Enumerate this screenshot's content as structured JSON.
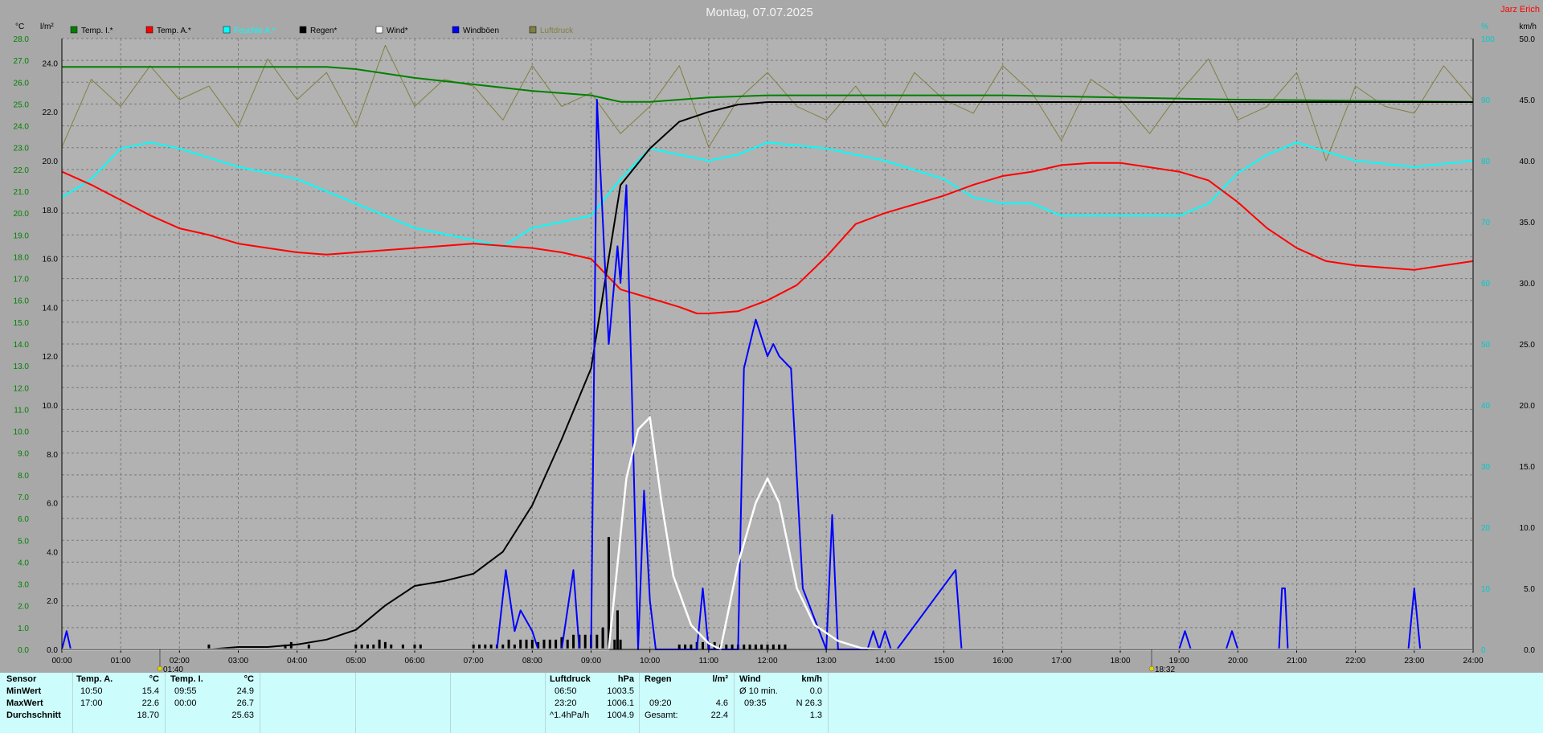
{
  "title": "Montag, 07.07.2025",
  "credit": "Jarz Erich",
  "colors": {
    "plot_bg": "#b2b2b2",
    "left_axis": "#008000",
    "right_axis": "#00c8c8",
    "grid": "#7a7a7a"
  },
  "axes": {
    "left_unit": "°C",
    "rain_unit": "l/m²",
    "right_unit": "km/h",
    "humidity_unit": "%"
  },
  "legend": [
    {
      "label": "Temp. I.*",
      "color": "#008000"
    },
    {
      "label": "Temp. A.*",
      "color": "#ff0000"
    },
    {
      "label": "Feuchte A.*",
      "color": "#00ffff"
    },
    {
      "label": "Regen*",
      "color": "#000000"
    },
    {
      "label": "Wind*",
      "color": "#ffffff"
    },
    {
      "label": "Windböen",
      "color": "#0000ff"
    },
    {
      "label": "Luftdruck",
      "color": "#808040"
    }
  ],
  "markers": [
    {
      "time": "01:40",
      "hour": 1.667
    },
    {
      "time": "18:32",
      "hour": 18.533
    }
  ],
  "chart_data": {
    "type": "line",
    "x_unit": "hour of day",
    "xlim": [
      0,
      24
    ],
    "x_tick_labels": [
      "00:00",
      "01:00",
      "02:00",
      "03:00",
      "04:00",
      "05:00",
      "06:00",
      "07:00",
      "08:00",
      "09:00",
      "10:00",
      "11:00",
      "12:00",
      "13:00",
      "14:00",
      "15:00",
      "16:00",
      "17:00",
      "18:00",
      "19:00",
      "20:00",
      "21:00",
      "22:00",
      "23:00",
      "24:00"
    ],
    "temp_axis": {
      "min": 0,
      "max": 28,
      "labels": [
        "28.0",
        "27.0",
        "26.0",
        "25.0",
        "24.0",
        "23.0",
        "22.0",
        "21.0",
        "20.0",
        "19.0",
        "18.0",
        "17.0",
        "16.0",
        "15.0",
        "14.0",
        "13.0",
        "12.0",
        "11.0",
        "10.0",
        "9.0",
        "8.0",
        "7.0",
        "6.0",
        "5.0",
        "4.0",
        "3.0",
        "2.0",
        "1.0",
        "0.0"
      ]
    },
    "rain_axis": {
      "min": 0,
      "max": 25,
      "labels": [
        "24.0",
        "22.0",
        "20.0",
        "18.0",
        "16.0",
        "14.0",
        "12.0",
        "10.0",
        "8.0",
        "6.0",
        "4.0",
        "2.0",
        "0.0"
      ]
    },
    "wind_axis": {
      "min": 0,
      "max": 50,
      "labels": [
        "50.0",
        "45.0",
        "40.0",
        "35.0",
        "30.0",
        "25.0",
        "20.0",
        "15.0",
        "10.0",
        "5.0",
        "0.0"
      ]
    },
    "humidity_axis": {
      "min": 0,
      "max": 100,
      "labels": [
        "100",
        "90",
        "80",
        "70",
        "60",
        "50",
        "40",
        "30",
        "20",
        "10",
        "0"
      ]
    },
    "series": [
      {
        "name": "Temp. I.*",
        "axis": "temp",
        "color": "#008000",
        "x": [
          0,
          4.5,
          5,
          6,
          7,
          8,
          9,
          9.5,
          10,
          11,
          12,
          13,
          16,
          20,
          24
        ],
        "y": [
          26.7,
          26.7,
          26.6,
          26.2,
          25.9,
          25.6,
          25.4,
          25.1,
          25.1,
          25.3,
          25.4,
          25.4,
          25.4,
          25.2,
          25.1
        ]
      },
      {
        "name": "Temp. A.*",
        "axis": "temp",
        "color": "#ff0000",
        "x": [
          0,
          0.5,
          1,
          1.5,
          2,
          2.5,
          3,
          3.5,
          4,
          4.5,
          5,
          5.5,
          6,
          6.5,
          7,
          7.5,
          8,
          8.5,
          9,
          9.5,
          10,
          10.5,
          10.8,
          11,
          11.5,
          12,
          12.5,
          13,
          13.5,
          14,
          14.5,
          15,
          15.5,
          16,
          16.5,
          17,
          17.5,
          18,
          18.5,
          19,
          19.5,
          20,
          20.5,
          21,
          21.5,
          22,
          22.5,
          23,
          23.5,
          24
        ],
        "y": [
          21.9,
          21.3,
          20.6,
          19.9,
          19.3,
          19.0,
          18.6,
          18.4,
          18.2,
          18.1,
          18.2,
          18.3,
          18.4,
          18.5,
          18.6,
          18.5,
          18.4,
          18.2,
          17.9,
          16.5,
          16.1,
          15.7,
          15.4,
          15.4,
          15.5,
          16.0,
          16.7,
          18.0,
          19.5,
          20.0,
          20.4,
          20.8,
          21.3,
          21.7,
          21.9,
          22.2,
          22.3,
          22.3,
          22.1,
          21.9,
          21.5,
          20.5,
          19.3,
          18.4,
          17.8,
          17.6,
          17.5,
          17.4,
          17.6,
          17.8
        ]
      },
      {
        "name": "Feuchte A.*",
        "axis": "humidity",
        "color": "#00ffff",
        "x": [
          0,
          0.5,
          1,
          1.5,
          2,
          3,
          4,
          5,
          6,
          7,
          7.5,
          8,
          9,
          9.5,
          10,
          11,
          11.5,
          12,
          13,
          14,
          15,
          15.5,
          16,
          16.5,
          17,
          18,
          19,
          19.5,
          20,
          20.5,
          21,
          22,
          23,
          24
        ],
        "y": [
          74,
          77,
          82,
          83,
          82,
          79,
          77,
          73,
          69,
          67,
          66,
          69,
          71,
          77,
          82,
          80,
          81,
          83,
          82,
          80,
          77,
          74,
          73,
          73,
          71,
          71,
          71,
          73,
          78,
          81,
          83,
          80,
          79,
          80
        ]
      },
      {
        "name": "Regen*",
        "axis": "rain",
        "color": "#000000",
        "x": [
          0,
          2.5,
          3,
          3.5,
          4,
          4.5,
          5,
          5.5,
          6,
          6.5,
          7,
          7.5,
          8,
          8.5,
          9,
          9.2,
          9.5,
          10,
          10.5,
          11,
          11.5,
          12,
          13,
          24
        ],
        "y": [
          0,
          0,
          0.1,
          0.1,
          0.2,
          0.4,
          0.8,
          1.8,
          2.6,
          2.8,
          3.1,
          4.0,
          5.9,
          8.6,
          11.5,
          14.5,
          19.0,
          20.5,
          21.6,
          22.0,
          22.3,
          22.4,
          22.4,
          22.4
        ]
      },
      {
        "name": "Wind*",
        "axis": "wind",
        "color": "#ffffff",
        "x": [
          0,
          9.3,
          9.6,
          9.8,
          10,
          10.2,
          10.4,
          10.7,
          11,
          11.2,
          11.5,
          11.8,
          12,
          12.2,
          12.5,
          12.8,
          13.2,
          13.6,
          14,
          24
        ],
        "y": [
          0,
          0,
          14,
          18,
          19,
          12,
          6,
          2,
          0.5,
          0,
          7,
          12,
          14,
          12,
          5,
          2,
          0.7,
          0.1,
          0,
          0
        ]
      },
      {
        "name": "Windböen",
        "axis": "wind",
        "color": "#0000ff",
        "x": [
          0,
          0.08,
          0.15,
          7.4,
          7.55,
          7.7,
          7.8,
          8.0,
          8.1,
          8.2,
          8.3,
          8.4,
          8.5,
          8.7,
          8.8,
          8.9,
          9.0,
          9.1,
          9.15,
          9.3,
          9.45,
          9.5,
          9.6,
          9.7,
          9.8,
          9.9,
          10.0,
          10.1,
          10.2,
          10.3,
          10.5,
          10.7,
          10.8,
          10.9,
          11.0,
          11.1,
          11.3,
          11.5,
          11.6,
          11.8,
          12.0,
          12.1,
          12.2,
          12.4,
          12.6,
          13.0,
          13.1,
          13.2,
          13.7,
          13.8,
          13.9,
          14.0,
          14.1,
          14.2,
          15.2,
          15.3,
          15.4,
          19.0,
          19.1,
          19.2,
          19.8,
          19.9,
          20.0,
          20.7,
          20.75,
          20.8,
          20.85,
          20.9,
          22.9,
          23.0,
          23.1,
          23.2,
          24
        ],
        "y": [
          0,
          1.5,
          0,
          0,
          6.5,
          1.5,
          3.2,
          1.5,
          0,
          0,
          0,
          0,
          0,
          6.5,
          0,
          0,
          0,
          45,
          40,
          25,
          33,
          30,
          38,
          20,
          0,
          13,
          4,
          0,
          0,
          0,
          0,
          0,
          0,
          5,
          0,
          0,
          0,
          0,
          23,
          27,
          24,
          25,
          24,
          23,
          5,
          0,
          11,
          0,
          0,
          1.5,
          0,
          1.5,
          0,
          0,
          6.5,
          0,
          0,
          0,
          1.5,
          0,
          0,
          1.5,
          0,
          0,
          5,
          5,
          0,
          0,
          0,
          5,
          0,
          0,
          0
        ]
      },
      {
        "name": "Luftdruck",
        "axis": "pressure",
        "color": "#808040",
        "x": [
          0,
          0.5,
          1,
          1.5,
          2,
          2.5,
          3,
          3.5,
          4,
          4.5,
          5,
          5.5,
          6,
          6.5,
          7,
          7.5,
          8,
          8.5,
          9,
          9.5,
          10,
          10.5,
          11,
          11.5,
          12,
          12.5,
          13,
          13.5,
          14,
          14.5,
          15,
          15.5,
          16,
          16.5,
          17,
          17.5,
          18,
          18.5,
          19,
          19.5,
          20,
          20.5,
          21,
          21.5,
          22,
          22.5,
          23,
          23.5,
          24
        ],
        "y": [
          1004.4,
          1005.4,
          1005.0,
          1005.6,
          1005.1,
          1005.3,
          1004.7,
          1005.7,
          1005.1,
          1005.5,
          1004.7,
          1005.9,
          1005.0,
          1005.4,
          1005.3,
          1004.8,
          1005.6,
          1005.0,
          1005.2,
          1004.6,
          1005.0,
          1005.6,
          1004.4,
          1005.1,
          1005.5,
          1005.0,
          1004.8,
          1005.3,
          1004.7,
          1005.5,
          1005.1,
          1004.9,
          1005.6,
          1005.2,
          1004.5,
          1005.4,
          1005.1,
          1004.6,
          1005.2,
          1005.7,
          1004.8,
          1005.0,
          1005.5,
          1004.2,
          1005.3,
          1005.0,
          1004.9,
          1005.6,
          1005.1
        ]
      }
    ],
    "rain_bars": {
      "name": "Regen (Intervall)",
      "axis": "rain",
      "color": "#000000",
      "x": [
        2.5,
        3.8,
        3.9,
        4.2,
        5.0,
        5.1,
        5.2,
        5.3,
        5.4,
        5.5,
        5.6,
        5.8,
        6.0,
        6.1,
        7.0,
        7.1,
        7.2,
        7.3,
        7.4,
        7.5,
        7.6,
        7.7,
        7.8,
        7.9,
        8.0,
        8.1,
        8.2,
        8.3,
        8.4,
        8.5,
        8.6,
        8.7,
        8.8,
        8.9,
        9.0,
        9.1,
        9.2,
        9.3,
        9.4,
        9.5,
        10.5,
        10.6,
        10.7,
        10.8,
        10.9,
        11.0,
        11.1,
        11.2,
        11.3,
        11.4,
        11.5,
        11.6,
        11.7,
        11.8,
        11.9,
        12.0,
        12.1,
        12.2,
        12.3
      ],
      "y": [
        0.2,
        0.2,
        0.3,
        0.2,
        0.2,
        0.2,
        0.2,
        0.2,
        0.4,
        0.3,
        0.2,
        0.2,
        0.2,
        0.2,
        0.2,
        0.2,
        0.2,
        0.2,
        0.2,
        0.2,
        0.4,
        0.2,
        0.4,
        0.4,
        0.4,
        0.3,
        0.4,
        0.4,
        0.4,
        0.5,
        0.4,
        0.6,
        0.6,
        0.6,
        0.6,
        0.6,
        0.8,
        0.4,
        0.4,
        0.4,
        0.2,
        0.2,
        0.2,
        0.3,
        0.3,
        0.3,
        0.3,
        0.2,
        0.2,
        0.2,
        0.2,
        0.2,
        0.2,
        0.2,
        0.2,
        0.2,
        0.2,
        0.2,
        0.2
      ]
    },
    "spike_bars": {
      "x": [
        9.2,
        9.3,
        9.45
      ],
      "y": [
        0.9,
        4.6,
        1.6
      ]
    }
  },
  "table": {
    "sensor_col": {
      "header": "Sensor",
      "rows": [
        "MinWert",
        "MaxWert",
        "Durchschnitt"
      ]
    },
    "temp_a": {
      "header": "Temp. A.",
      "unit": "°C",
      "times": [
        "10:50",
        "17:00",
        ""
      ],
      "values": [
        "15.4",
        "22.6",
        "18.70"
      ]
    },
    "temp_i": {
      "header": "Temp. I.",
      "unit": "°C",
      "times": [
        "09:55",
        "00:00",
        ""
      ],
      "values": [
        "24.9",
        "26.7",
        "25.63"
      ]
    },
    "pressure": {
      "header": "Luftdruck",
      "unit": "hPa",
      "times": [
        "06:50",
        "23:20",
        "^1.4hPa/h"
      ],
      "values": [
        "1003.5",
        "1006.1",
        "1004.9"
      ]
    },
    "rain": {
      "header": "Regen",
      "unit": "l/m²",
      "times": [
        "",
        "09:20",
        "Gesamt:"
      ],
      "values": [
        "",
        "4.6",
        "22.4"
      ]
    },
    "wind": {
      "header": "Wind",
      "unit": "km/h",
      "times": [
        "Ø 10 min.",
        "09:35",
        ""
      ],
      "values": [
        "0.0",
        "N 26.3",
        "1.3"
      ]
    }
  }
}
